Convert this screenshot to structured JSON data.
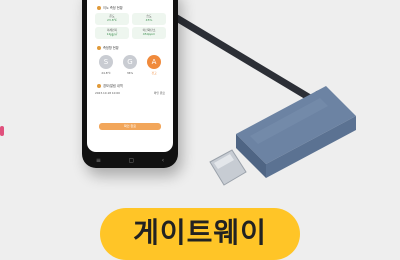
{
  "colors": {
    "background": "#eeeeee",
    "accent_left": "#e0507c",
    "badge_yellow": "#ffc527",
    "antenna_dark": "#2c2f36",
    "dongle_blue": "#5e7596",
    "usb_metal": "#c7ccd3"
  },
  "phone": {
    "section_1_title": "이노 측정 현황",
    "cards": [
      {
        "label": "온도",
        "value": "23.8℃"
      },
      {
        "label": "습도",
        "value": "45%"
      },
      {
        "label": "미세먼지",
        "value": "12㎍/㎥"
      },
      {
        "label": "이산화탄소",
        "value": "450ppm"
      }
    ],
    "section_2_title": "측정항 현황",
    "circles": [
      {
        "letter": "S",
        "caption": "24.8℃",
        "state": "normal"
      },
      {
        "letter": "G",
        "caption": "36%",
        "state": "normal"
      },
      {
        "letter": "A",
        "caption": "경고",
        "state": "alert"
      }
    ],
    "section_3_title": "경보/알림 내역",
    "alert_item": {
      "text": "2023.10.18 10:00",
      "status": "확인 완료"
    },
    "button_label": "확인 완료"
  },
  "badge": {
    "label": "게이트웨이"
  }
}
